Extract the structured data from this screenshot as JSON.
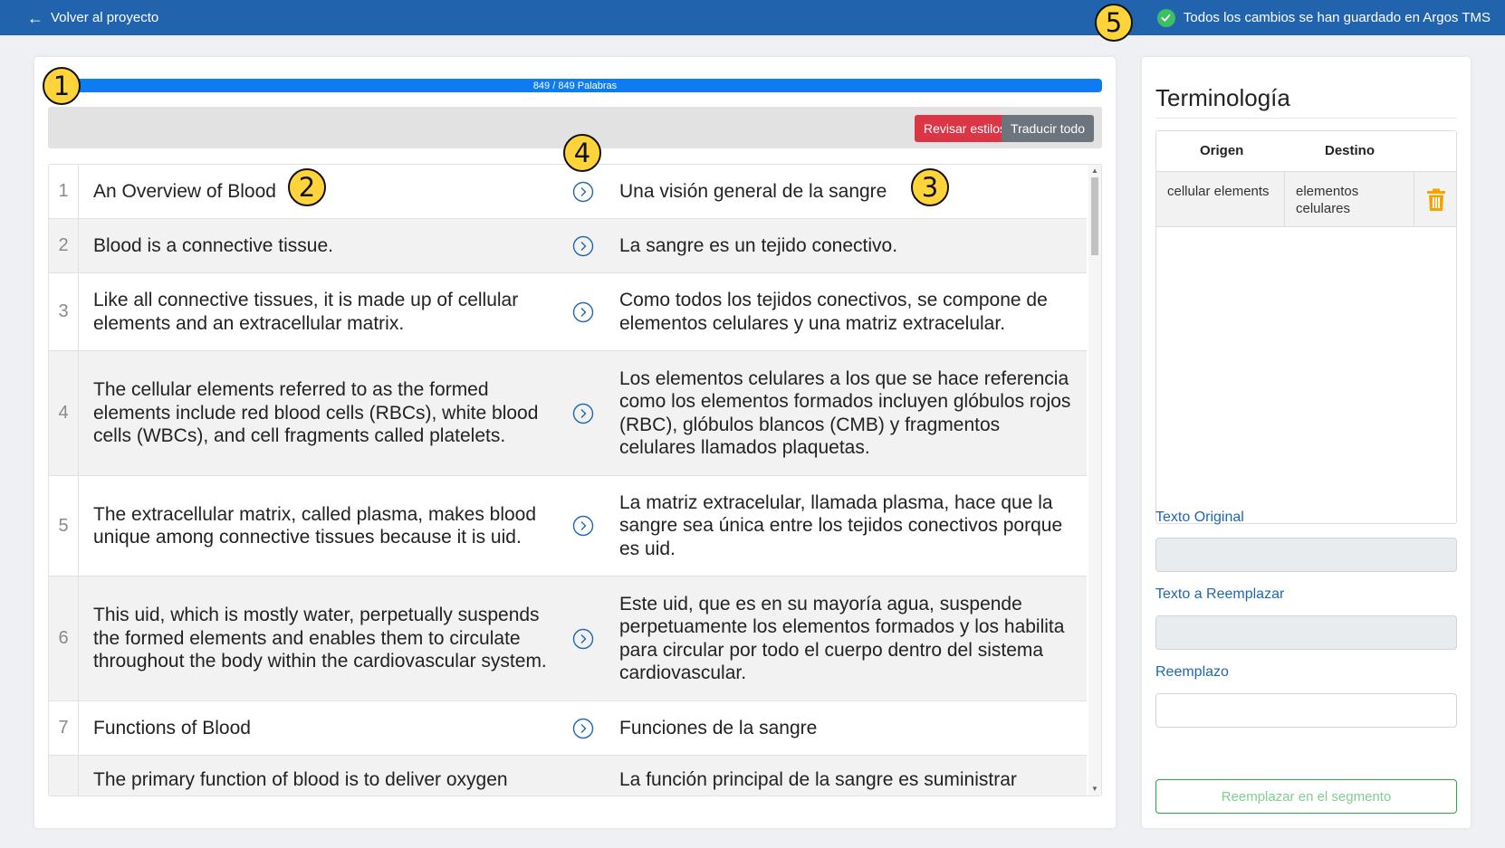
{
  "topbar": {
    "back_label": "Volver al proyecto",
    "saved_status": "Todos los cambios se han guardado en Argos TMS"
  },
  "progress": {
    "label": "849 / 849 Palabras",
    "fraction": 1.0
  },
  "toolbar": {
    "review_styles": "Revisar estilos",
    "translate_all": "Traducir todo"
  },
  "segments": [
    {
      "num": "1",
      "source": "An Overview of Blood",
      "target": "Una visión general de la sangre"
    },
    {
      "num": "2",
      "source": "Blood is a connective tissue.",
      "target": "La sangre es un tejido conectivo."
    },
    {
      "num": "3",
      "source": "Like all connective tissues, it is made up of cellular elements and an extracellular matrix.",
      "target": "Como todos los tejidos conectivos, se compone de elementos celulares y una matriz extracelular."
    },
    {
      "num": "4",
      "source": "The cellular elements referred to as the formed elements include red blood cells (RBCs), white blood cells (WBCs), and cell fragments called platelets.",
      "target": "Los elementos celulares a los que se hace referencia como los elementos formados incluyen glóbulos rojos (RBC), glóbulos blancos (CMB) y fragmentos celulares llamados plaquetas."
    },
    {
      "num": "5",
      "source": "The extracellular matrix, called plasma, makes blood unique among connective tissues because it is uid.",
      "target": "La matriz extracelular, llamada plasma, hace que la sangre sea única entre los tejidos conectivos porque es uid."
    },
    {
      "num": "6",
      "source": "This uid, which is mostly water, perpetually suspends the formed elements and enables them to circulate throughout the body within the cardiovascular system.",
      "target": "Este uid, que es en su mayoría agua, suspende perpetuamente los elementos formados y los habilita para circular por todo el cuerpo dentro del sistema cardiovascular."
    },
    {
      "num": "7",
      "source": "Functions of Blood",
      "target": "Funciones de la sangre"
    },
    {
      "num": "",
      "source": "The primary function of blood is to deliver oxygen",
      "target": "La función principal de la sangre es suministrar"
    }
  ],
  "terminology": {
    "title": "Terminología",
    "col_source": "Origen",
    "col_target": "Destino",
    "rows": [
      {
        "source": "cellular elements",
        "target": "elementos celulares"
      }
    ]
  },
  "replace": {
    "original_label": "Texto Original",
    "original_value": "",
    "to_replace_label": "Texto a Reemplazar",
    "to_replace_value": "",
    "replacement_label": "Reemplazo",
    "replacement_value": "",
    "button_label": "Reemplazar en el segmento"
  },
  "markers": [
    "1",
    "2",
    "3",
    "4",
    "5"
  ],
  "colors": {
    "topbar": "#2164ad",
    "progress": "#0d7cf2",
    "danger": "#dc3545",
    "secondary": "#6c757d",
    "success": "#28a745",
    "marker": "#ffd43b"
  }
}
